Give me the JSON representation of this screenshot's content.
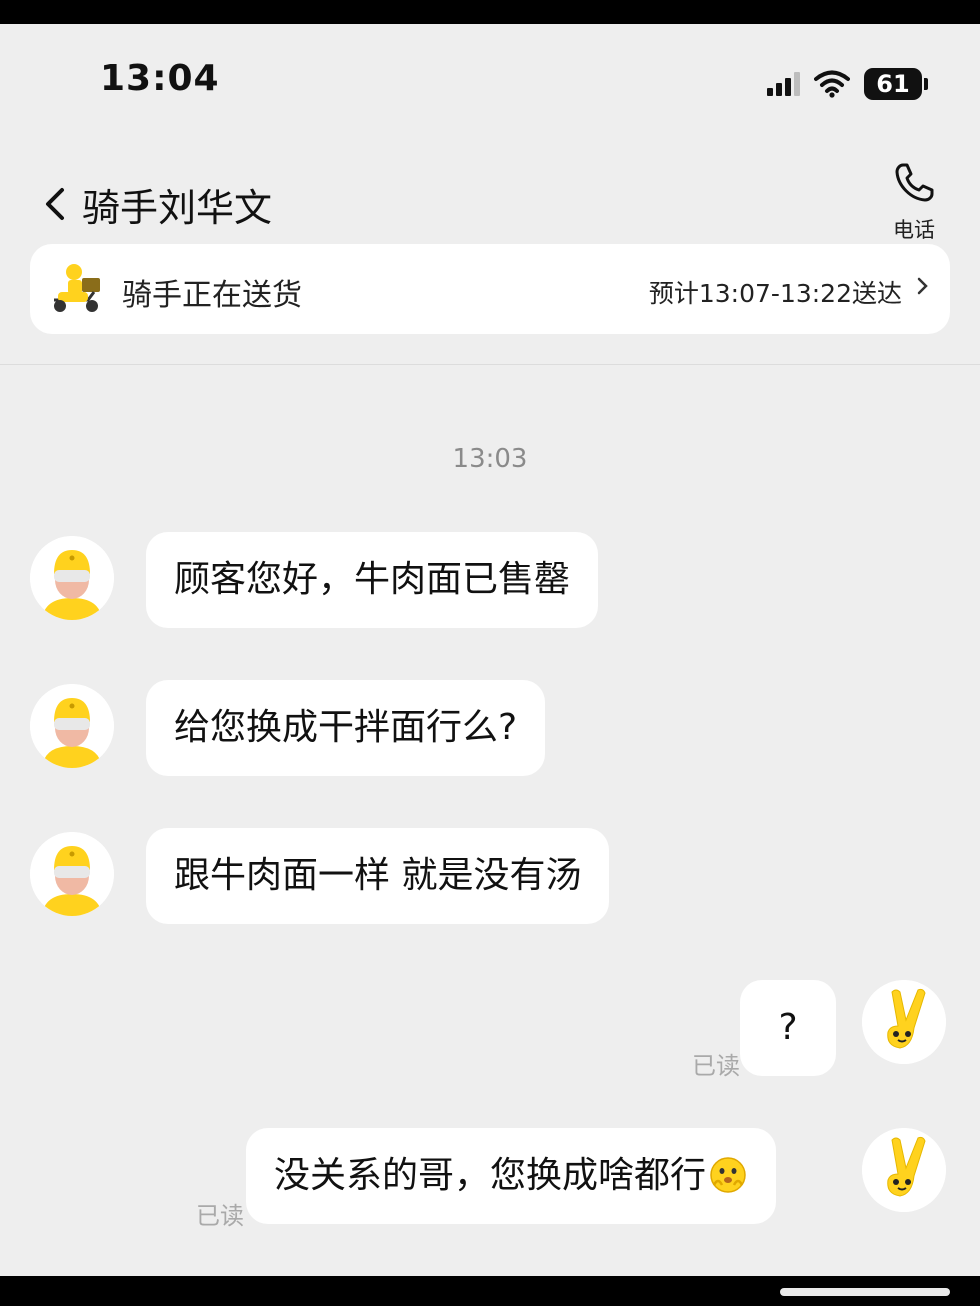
{
  "status_bar": {
    "time": "13:04",
    "battery": "61"
  },
  "header": {
    "title": "骑手刘华文",
    "call_label": "电话"
  },
  "delivery": {
    "status": "骑手正在送货",
    "eta": "预计13:07-13:22送达"
  },
  "chat": {
    "timestamp": "13:03",
    "messages": [
      {
        "from": "rider",
        "text": "顾客您好，牛肉面已售罄"
      },
      {
        "from": "rider",
        "text": "给您换成干拌面行么?"
      },
      {
        "from": "rider",
        "text": "跟牛肉面一样 就是没有汤"
      },
      {
        "from": "me",
        "text": "?",
        "read": "已读"
      },
      {
        "from": "me",
        "text": "没关系的哥，您换成啥都行",
        "read": "已读",
        "emoji": "flushed-hands-emoji"
      }
    ]
  },
  "colors": {
    "accent_yellow": "#ffd21e",
    "background": "#eeeeee",
    "bubble": "#ffffff"
  }
}
